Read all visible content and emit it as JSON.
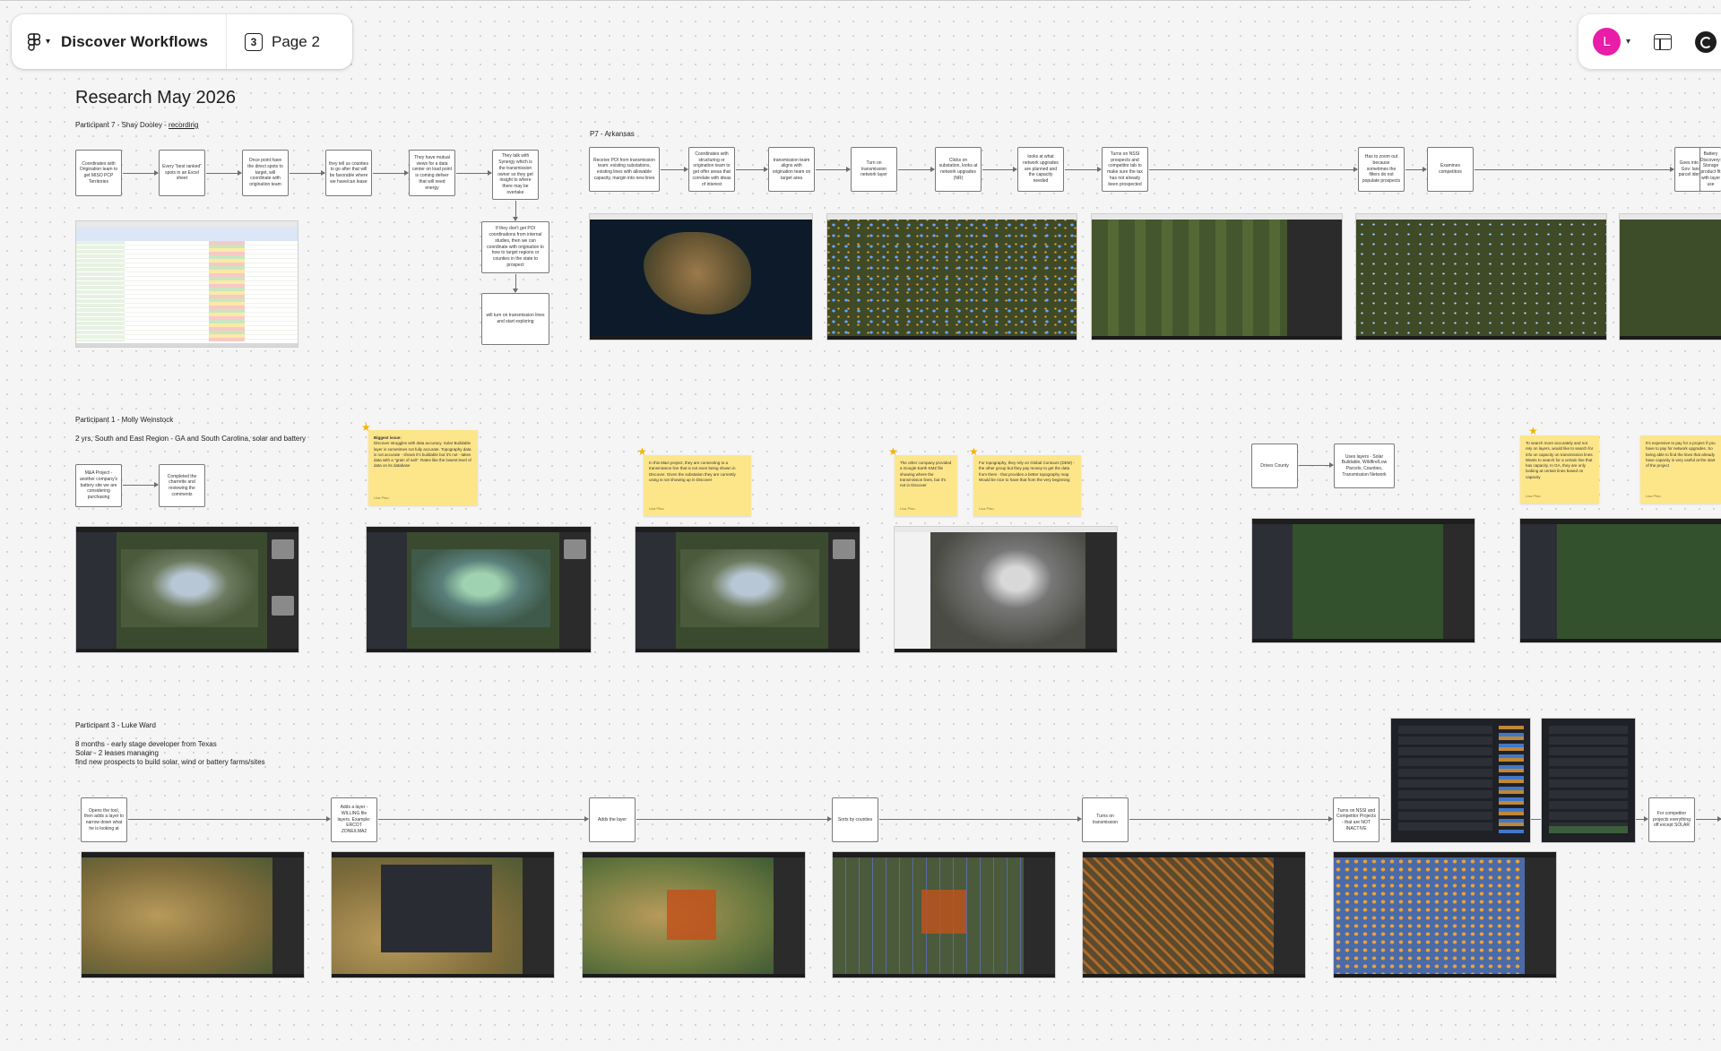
{
  "toolbar": {
    "file_title": "Discover Workflows",
    "page_number": "3",
    "page_label": "Page 2",
    "avatar_initial": "L",
    "avatar_color": "#e81da8"
  },
  "board": {
    "title": "Research May 2026",
    "p7": {
      "label_name": "Participant 7 - Shay Dooley - ",
      "label_link": "recording",
      "steps": [
        "Coordinates with Origination team to get MISO PCP Territories",
        "Every \"best ranked\" spots in an Excel sheet",
        "Once point have the direct spots to target, will coordinate with origination team",
        "they tell us counties to go after that will be favorable where we have/can lease",
        "They have mutual views for a data center on load point is coming deliver that will need energy",
        "They talk with Synergy which is the transmission owner so they get insight to where there may be overtake",
        "If they don't get POI coordinations from internal studies, then we can coordinate with origination to how to target regions or counties in the state to prospect",
        "will turn on transmission lines and start exploring"
      ]
    },
    "p7b": {
      "label": "P7 - Arkansas",
      "steps": [
        "Receive POI from transmission team: existing substations, existing lines with allowable capacity, margin into new lines",
        "Coordinates with structuring or origination team to get offer areas that correlate with ideas of interest",
        "transmission team aligns with origination team on target area",
        "Turn on transmission network layer",
        "Clicks on substation, looks at network upgrades (NR)",
        "looks at what network upgrades are planned and the capacity needed",
        "Turns on NSSI prospects and competitor tab to make sure the tax has not already been prospected",
        "Has to zoom out because sometimes the filters do not populate prospects",
        "Examines competitors",
        "Goes into Whitney Gov: land owner parcel identification",
        "Battery Discovery: Storage product fit with layer use"
      ]
    },
    "p1": {
      "name": "Participant 1 - Molly Weinstock",
      "meta": "2 yrs, South and East Region - GA and South Carolina, solar and battery",
      "steps": [
        "M&A Project - another company's battery site we are considering purchasing",
        "Completed the charrette and reviewing the comments",
        "Drives County",
        "Uses layers - Solar Buildable, Wildfire/Low Parcels, Counties, Transmission Network"
      ],
      "notes": [
        {
          "head": "Biggest issue:",
          "body": "Discover struggles with data accuracy. Solar Buildable layer is sometimes not fully accurate. Topography data is not accurate - shows it's buildable but it's not - takes data with a \"grain of salt\". Rates like the lowest level of data on its database",
          "who": "Lisa Pfau"
        },
        {
          "head": "",
          "body": "In this M&A project, they are connecting to a transmission line that is not even being shown in Discover. Given the substation they are currently using is not showing up in Discover",
          "who": "Lisa Pfau"
        },
        {
          "head": "",
          "body": "The other company provided a Google Earth KMZ file showing where the transmission lines, but it's not in Discover",
          "who": "Lisa Pfau"
        },
        {
          "head": "",
          "body": "For topography, they rely on Global Contours (DEM) - the other group but they pay money to get the data from them - that provides a better topography map. Would be nice to have that from the very beginning",
          "who": "Lisa Pfau"
        },
        {
          "head": "",
          "body": "To search more accurately and not rely on layers, would like to search for info on capacity on transmission lines. Wants to search for a certain line that has capacity. In GA, they are only looking at certain lines based on capacity",
          "who": "Lisa Pfau"
        },
        {
          "head": "",
          "body": "It's expensive to pay for a project if you have to pay for network upgrades. So being able to find the lines that already have capacity is very useful at the start of the project",
          "who": "Lisa Pfau"
        }
      ]
    },
    "p3": {
      "name": "Participant 3 - Luke Ward",
      "meta1": "8 months - early stage developer from Texas",
      "meta2": "Solar - 2 leases managing",
      "meta3": "find new prospects to build solar, wind or battery farms/sites",
      "steps": [
        "Opens the tool, then adds a layer to narrow down what he is looking at",
        "Adds a layer - WILLING file layers. Example: ERCOT ZONE/LMA2",
        "Adds the layer",
        "Sorts by counties",
        "Turns on transmission",
        "Turns on NSSI and Competitor Projects - that are NOT INACTIVE",
        "For competitor projects everything off except SOLAR"
      ]
    }
  }
}
